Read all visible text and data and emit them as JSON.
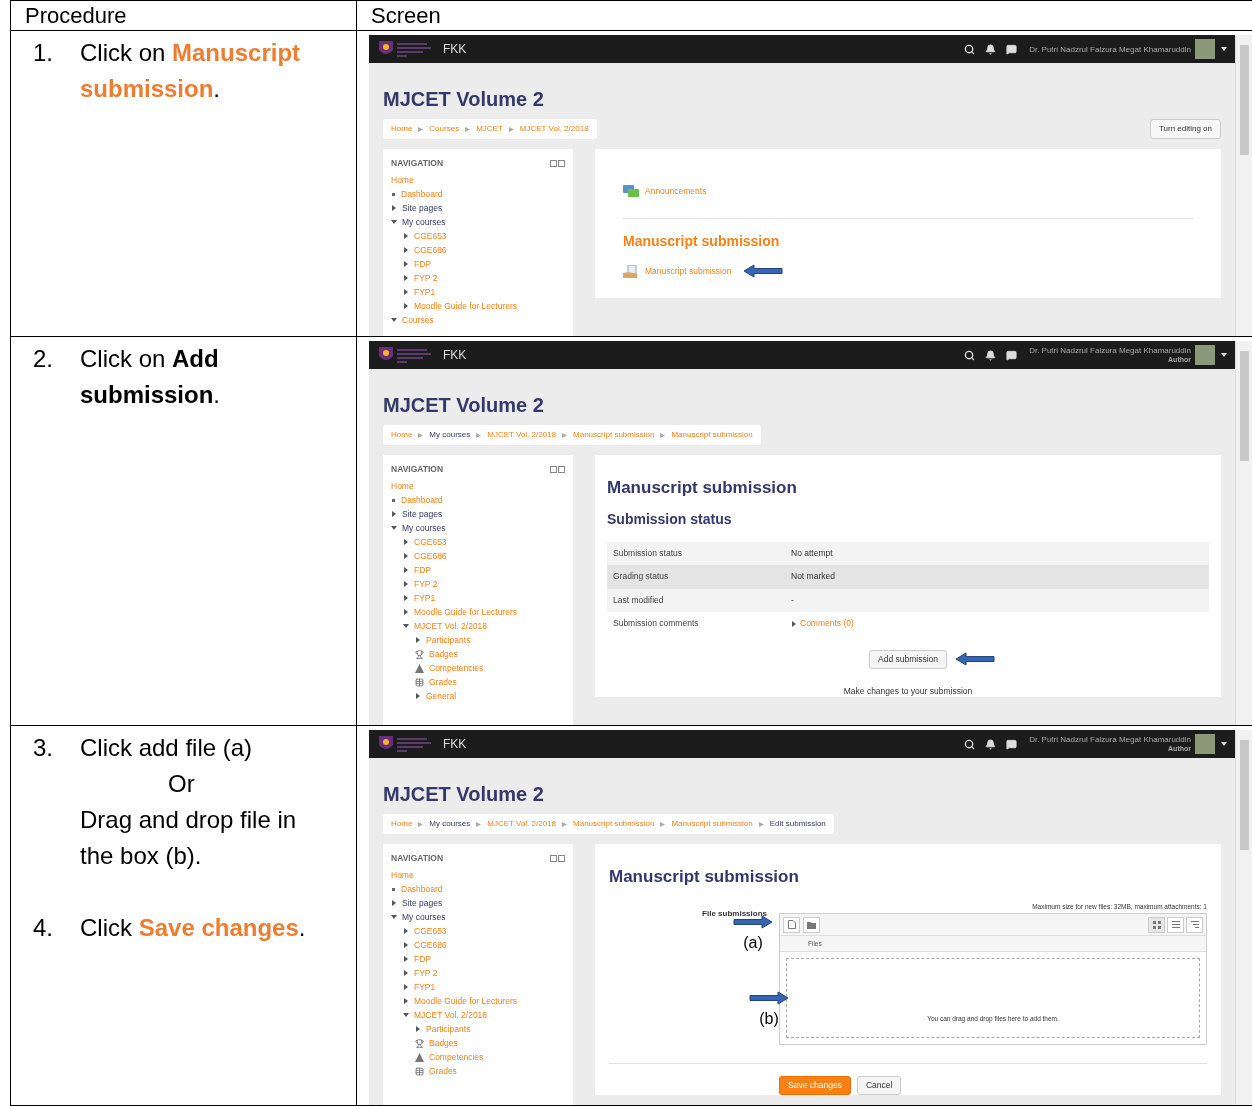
{
  "table": {
    "columns": [
      "Procedure",
      "Screen"
    ],
    "rows": [
      {
        "procedure": [
          {
            "number": "1.",
            "lines": [
              {
                "kind": "text",
                "parts": [
                  {
                    "text": "Click on ",
                    "kind": "plain"
                  },
                  {
                    "text": "Manuscript submission",
                    "kind": "accent"
                  },
                  {
                    "text": ".",
                    "kind": "plain"
                  }
                ]
              }
            ]
          }
        ],
        "screen": {
          "site_name": "FKK",
          "user_name": "Dr. Putri Nadzrul Faizura Megat Khamaruddin",
          "page_title": "MJCET Volume 2",
          "breadcrumb": [
            {
              "label": "Home",
              "link": true
            },
            {
              "label": "Courses",
              "link": true
            },
            {
              "label": "MJCET",
              "link": true
            },
            {
              "label": "MJCET Vol. 2/2018",
              "link": true
            }
          ],
          "edit_button": "Turn editing on",
          "navigation": {
            "title": "NAVIGATION",
            "items": [
              {
                "label": "Home",
                "kind": "plain",
                "link": true
              },
              {
                "label": "Dashboard",
                "kind": "bullet",
                "link": true
              },
              {
                "label": "Site pages",
                "kind": "branch",
                "expanded": false,
                "link": false
              },
              {
                "label": "My courses",
                "kind": "branch",
                "expanded": true,
                "link": false,
                "children": [
                  {
                    "label": "CGE653",
                    "kind": "branch",
                    "expanded": false,
                    "link": true
                  },
                  {
                    "label": "CGE686",
                    "kind": "branch",
                    "expanded": false,
                    "link": true
                  },
                  {
                    "label": "FDP",
                    "kind": "branch",
                    "expanded": false,
                    "link": true
                  },
                  {
                    "label": "FYP 2",
                    "kind": "branch",
                    "expanded": false,
                    "link": true
                  },
                  {
                    "label": "FYP1",
                    "kind": "branch",
                    "expanded": false,
                    "link": true
                  },
                  {
                    "label": "Moodle Guide for Lecturers",
                    "kind": "branch",
                    "expanded": false,
                    "link": true
                  }
                ]
              },
              {
                "label": "Courses",
                "kind": "branch",
                "expanded": true,
                "link": true
              }
            ]
          },
          "content": {
            "kind": "course_sections",
            "sections": [
              {
                "items": [
                  {
                    "label": "Announcements",
                    "kind": "forum",
                    "pointer": false
                  }
                ]
              },
              {
                "title": "Manuscript submission",
                "items": [
                  {
                    "label": "Manuscript submission",
                    "kind": "assignment",
                    "pointer": true
                  }
                ]
              }
            ]
          }
        }
      },
      {
        "procedure": [
          {
            "number": "2.",
            "lines": [
              {
                "kind": "text",
                "parts": [
                  {
                    "text": "Click on ",
                    "kind": "plain"
                  },
                  {
                    "text": "Add submission",
                    "kind": "bold"
                  },
                  {
                    "text": ".",
                    "kind": "plain"
                  }
                ]
              }
            ]
          }
        ],
        "screen": {
          "site_name": "FKK",
          "user_name": "Dr. Putri Nadzrul Faizura Megat Khamaruddin",
          "user_role": "Author",
          "page_title": "MJCET Volume 2",
          "breadcrumb": [
            {
              "label": "Home",
              "link": true
            },
            {
              "label": "My courses",
              "link": false
            },
            {
              "label": "MJCET Vol. 2/2018",
              "link": true
            },
            {
              "label": "Manuscript submission",
              "link": true
            },
            {
              "label": "Manuscript submission",
              "link": true
            }
          ],
          "navigation": {
            "title": "NAVIGATION",
            "items": [
              {
                "label": "Home",
                "kind": "plain",
                "link": true
              },
              {
                "label": "Dashboard",
                "kind": "bullet",
                "link": true
              },
              {
                "label": "Site pages",
                "kind": "branch",
                "expanded": false,
                "link": false
              },
              {
                "label": "My courses",
                "kind": "branch",
                "expanded": true,
                "link": false,
                "children": [
                  {
                    "label": "CGE653",
                    "kind": "branch",
                    "expanded": false,
                    "link": true
                  },
                  {
                    "label": "CGE686",
                    "kind": "branch",
                    "expanded": false,
                    "link": true
                  },
                  {
                    "label": "FDP",
                    "kind": "branch",
                    "expanded": false,
                    "link": true
                  },
                  {
                    "label": "FYP 2",
                    "kind": "branch",
                    "expanded": false,
                    "link": true
                  },
                  {
                    "label": "FYP1",
                    "kind": "branch",
                    "expanded": false,
                    "link": true
                  },
                  {
                    "label": "Moodle Guide for Lecturers",
                    "kind": "branch",
                    "expanded": false,
                    "link": true
                  },
                  {
                    "label": "MJCET Vol. 2/2018",
                    "kind": "branch",
                    "expanded": true,
                    "link": true,
                    "children": [
                      {
                        "label": "Participants",
                        "kind": "branch",
                        "expanded": false,
                        "link": true
                      },
                      {
                        "label": "Badges",
                        "kind": "trophy",
                        "link": true
                      },
                      {
                        "label": "Competencies",
                        "kind": "pyramid",
                        "link": true
                      },
                      {
                        "label": "Grades",
                        "kind": "grid",
                        "link": true
                      },
                      {
                        "label": "General",
                        "kind": "branch",
                        "expanded": false,
                        "link": true
                      }
                    ]
                  }
                ]
              }
            ]
          },
          "content": {
            "kind": "submission_status",
            "title": "Manuscript submission",
            "subtitle": "Submission status",
            "rows": [
              {
                "label": "Submission status",
                "value": "No attempt",
                "kind": "text",
                "highlighted": false
              },
              {
                "label": "Grading status",
                "value": "Not marked",
                "kind": "text",
                "highlighted": true
              },
              {
                "label": "Last modified",
                "value": "-",
                "kind": "text",
                "highlighted": false
              },
              {
                "label": "Submission comments",
                "value": "Comments (0)",
                "kind": "link",
                "highlighted": false
              }
            ],
            "button": "Add submission",
            "button_pointer": true,
            "note": "Make changes to your submission"
          }
        }
      },
      {
        "procedure": [
          {
            "number": "3.",
            "lines": [
              {
                "kind": "text",
                "parts": [
                  {
                    "text": "Click add file (a)",
                    "kind": "plain"
                  }
                ]
              },
              {
                "kind": "connector",
                "parts": [
                  {
                    "text": "Or",
                    "kind": "plain"
                  }
                ]
              },
              {
                "kind": "text",
                "parts": [
                  {
                    "text": "Drag and drop file in the box (b).",
                    "kind": "plain"
                  }
                ]
              }
            ]
          },
          {
            "number": "4.",
            "lines": [
              {
                "kind": "text",
                "parts": [
                  {
                    "text": "Click ",
                    "kind": "plain"
                  },
                  {
                    "text": "Save changes",
                    "kind": "accent"
                  },
                  {
                    "text": ".",
                    "kind": "plain"
                  }
                ]
              }
            ]
          }
        ],
        "screen": {
          "site_name": "FKK",
          "user_name": "Dr. Putri Nadzrul Faizura Megat Khamaruddin",
          "user_role": "Author",
          "page_title": "MJCET Volume 2",
          "breadcrumb": [
            {
              "label": "Home",
              "link": true
            },
            {
              "label": "My courses",
              "link": false
            },
            {
              "label": "MJCET Vol. 2/2018",
              "link": true
            },
            {
              "label": "Manuscript submission",
              "link": true
            },
            {
              "label": "Manuscript submission",
              "link": true
            },
            {
              "label": "Edit submission",
              "link": false
            }
          ],
          "navigation": {
            "title": "NAVIGATION",
            "items": [
              {
                "label": "Home",
                "kind": "plain",
                "link": true
              },
              {
                "label": "Dashboard",
                "kind": "bullet",
                "link": true
              },
              {
                "label": "Site pages",
                "kind": "branch",
                "expanded": false,
                "link": false
              },
              {
                "label": "My courses",
                "kind": "branch",
                "expanded": true,
                "link": false,
                "children": [
                  {
                    "label": "CGE653",
                    "kind": "branch",
                    "expanded": false,
                    "link": true
                  },
                  {
                    "label": "CGE686",
                    "kind": "branch",
                    "expanded": false,
                    "link": true
                  },
                  {
                    "label": "FDP",
                    "kind": "branch",
                    "expanded": false,
                    "link": true
                  },
                  {
                    "label": "FYP 2",
                    "kind": "branch",
                    "expanded": false,
                    "link": true
                  },
                  {
                    "label": "FYP1",
                    "kind": "branch",
                    "expanded": false,
                    "link": true
                  },
                  {
                    "label": "Moodle Guide for Lecturers",
                    "kind": "branch",
                    "expanded": false,
                    "link": true
                  },
                  {
                    "label": "MJCET Vol. 2/2018",
                    "kind": "branch",
                    "expanded": true,
                    "link": true,
                    "children": [
                      {
                        "label": "Participants",
                        "kind": "branch",
                        "expanded": false,
                        "link": true
                      },
                      {
                        "label": "Badges",
                        "kind": "trophy",
                        "link": true
                      },
                      {
                        "label": "Competencies",
                        "kind": "pyramid",
                        "link": true
                      },
                      {
                        "label": "Grades",
                        "kind": "grid",
                        "link": true
                      }
                    ]
                  }
                ]
              }
            ]
          },
          "content": {
            "kind": "edit_submission",
            "title": "Manuscript submission",
            "field_label": "File submissions",
            "limits": "Maximum size for new files: 32MB, maximum attachments: 1",
            "files_header": "Files",
            "drop_hint": "You can drag and drop files here to add them.",
            "callouts": [
              {
                "label": "(a)",
                "kind": "toolbar"
              },
              {
                "label": "(b)",
                "kind": "dropzone"
              }
            ],
            "buttons": [
              {
                "label": "Save changes",
                "primary": true
              },
              {
                "label": "Cancel",
                "primary": false
              }
            ]
          }
        }
      }
    ]
  }
}
